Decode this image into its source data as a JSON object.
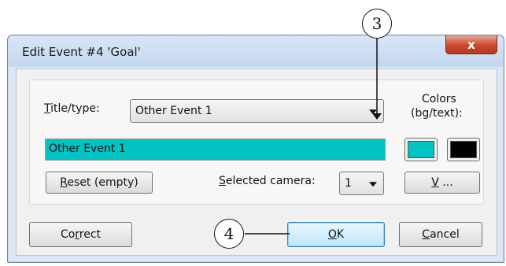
{
  "dialog": {
    "title": "Edit Event #4 'Goal'",
    "close_glyph": "x"
  },
  "fields": {
    "title_type": {
      "label_mnemonic": "T",
      "label_rest": "itle/type:",
      "value": "Other Event 1"
    },
    "event_name_value": "Other Event 1",
    "colors_label_line1": "Colors",
    "colors_label_line2": "(bg/text):",
    "camera": {
      "label_mnemonic": "S",
      "label_rest": "elected camera:",
      "value": "1"
    }
  },
  "colors": {
    "bg": "#00c4c4",
    "text": "#000000",
    "close_button": "#c9482a"
  },
  "buttons": {
    "reset": {
      "mnemonic": "R",
      "rest": "eset (empty)"
    },
    "v": {
      "mnemonic": "V",
      "rest": " ..."
    },
    "correct": {
      "before": "Co",
      "mnemonic": "r",
      "rest": "rect"
    },
    "ok": {
      "mnemonic": "O",
      "rest": "K"
    },
    "cancel": {
      "mnemonic": "C",
      "rest": "ancel"
    }
  },
  "callouts": [
    "3",
    "4"
  ]
}
